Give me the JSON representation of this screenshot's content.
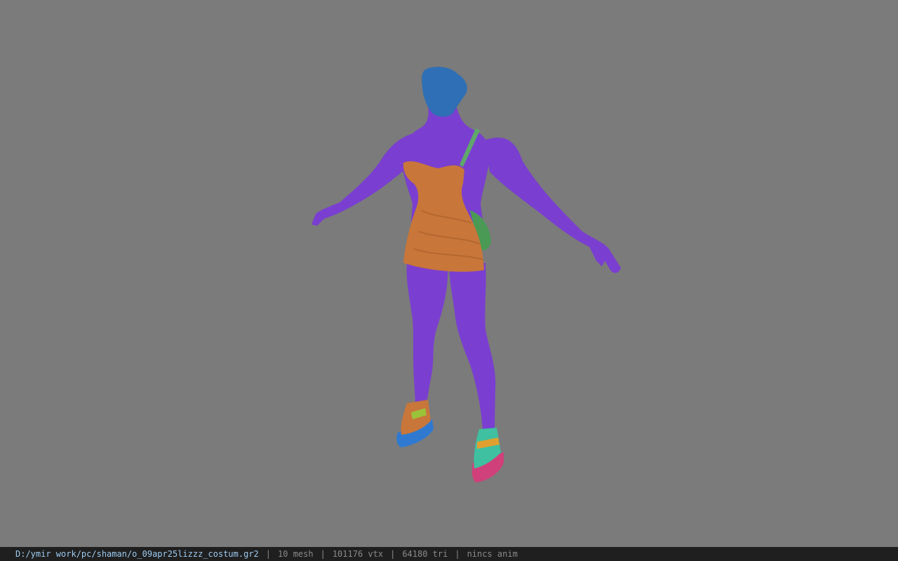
{
  "viewport": {
    "background": "#7b7b7b",
    "model": "character-tpose",
    "material_colors": {
      "head": "#2f6fb5",
      "body": "#7a3fd0",
      "dress": "#c8763a",
      "strap": "#5fa86a",
      "bag": "#4a9a55",
      "shoe_left_upper": "#c8763a",
      "shoe_left_sole": "#2f7ad0",
      "shoe_left_band": "#9ac33a",
      "shoe_right_upper": "#3fc0a0",
      "shoe_right_sole": "#d0407a",
      "shoe_right_band": "#e0a030"
    }
  },
  "statusbar": {
    "path": "D:/ymir work/pc/shaman/o_09apr25lizzz_costum.gr2",
    "mesh": "10 mesh",
    "vtx": "101176 vtx",
    "tri": "64180 tri",
    "anim": "nincs anim",
    "separator": "|"
  }
}
